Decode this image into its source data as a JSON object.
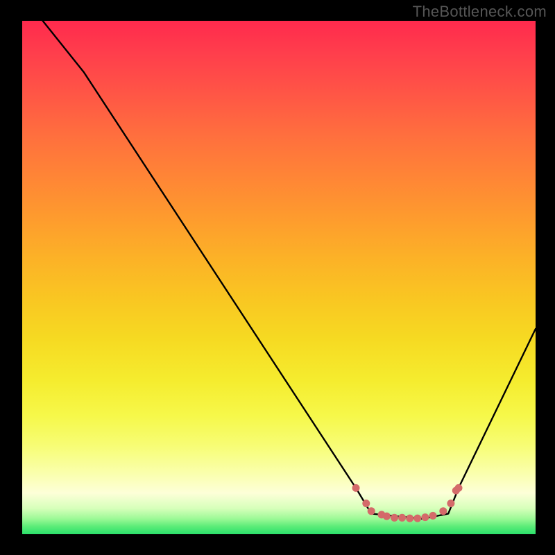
{
  "watermark": "TheBottleneck.com",
  "chart_data": {
    "type": "line",
    "title": "",
    "xlabel": "",
    "ylabel": "",
    "xlim": [
      0,
      100
    ],
    "ylim": [
      0,
      100
    ],
    "series": [
      {
        "name": "curve",
        "x": [
          4,
          12,
          65,
          68,
          78,
          83,
          85,
          100
        ],
        "y": [
          100,
          90,
          9,
          4,
          3,
          4,
          9,
          40
        ]
      }
    ],
    "markers": {
      "name": "bottom-cluster",
      "color": "#d46a6a",
      "points": [
        {
          "x": 65,
          "y": 9
        },
        {
          "x": 67,
          "y": 6
        },
        {
          "x": 68,
          "y": 4.5
        },
        {
          "x": 70,
          "y": 3.8
        },
        {
          "x": 71,
          "y": 3.5
        },
        {
          "x": 72.5,
          "y": 3.2
        },
        {
          "x": 74,
          "y": 3.2
        },
        {
          "x": 75.5,
          "y": 3.1
        },
        {
          "x": 77,
          "y": 3.1
        },
        {
          "x": 78.5,
          "y": 3.3
        },
        {
          "x": 80,
          "y": 3.6
        },
        {
          "x": 82,
          "y": 4.5
        },
        {
          "x": 83.5,
          "y": 6
        },
        {
          "x": 84.5,
          "y": 8.5
        },
        {
          "x": 85,
          "y": 9
        }
      ]
    },
    "background_gradient": {
      "top": "#ff2a4d",
      "mid": "#f6da22",
      "bottom": "#2be06b"
    }
  }
}
